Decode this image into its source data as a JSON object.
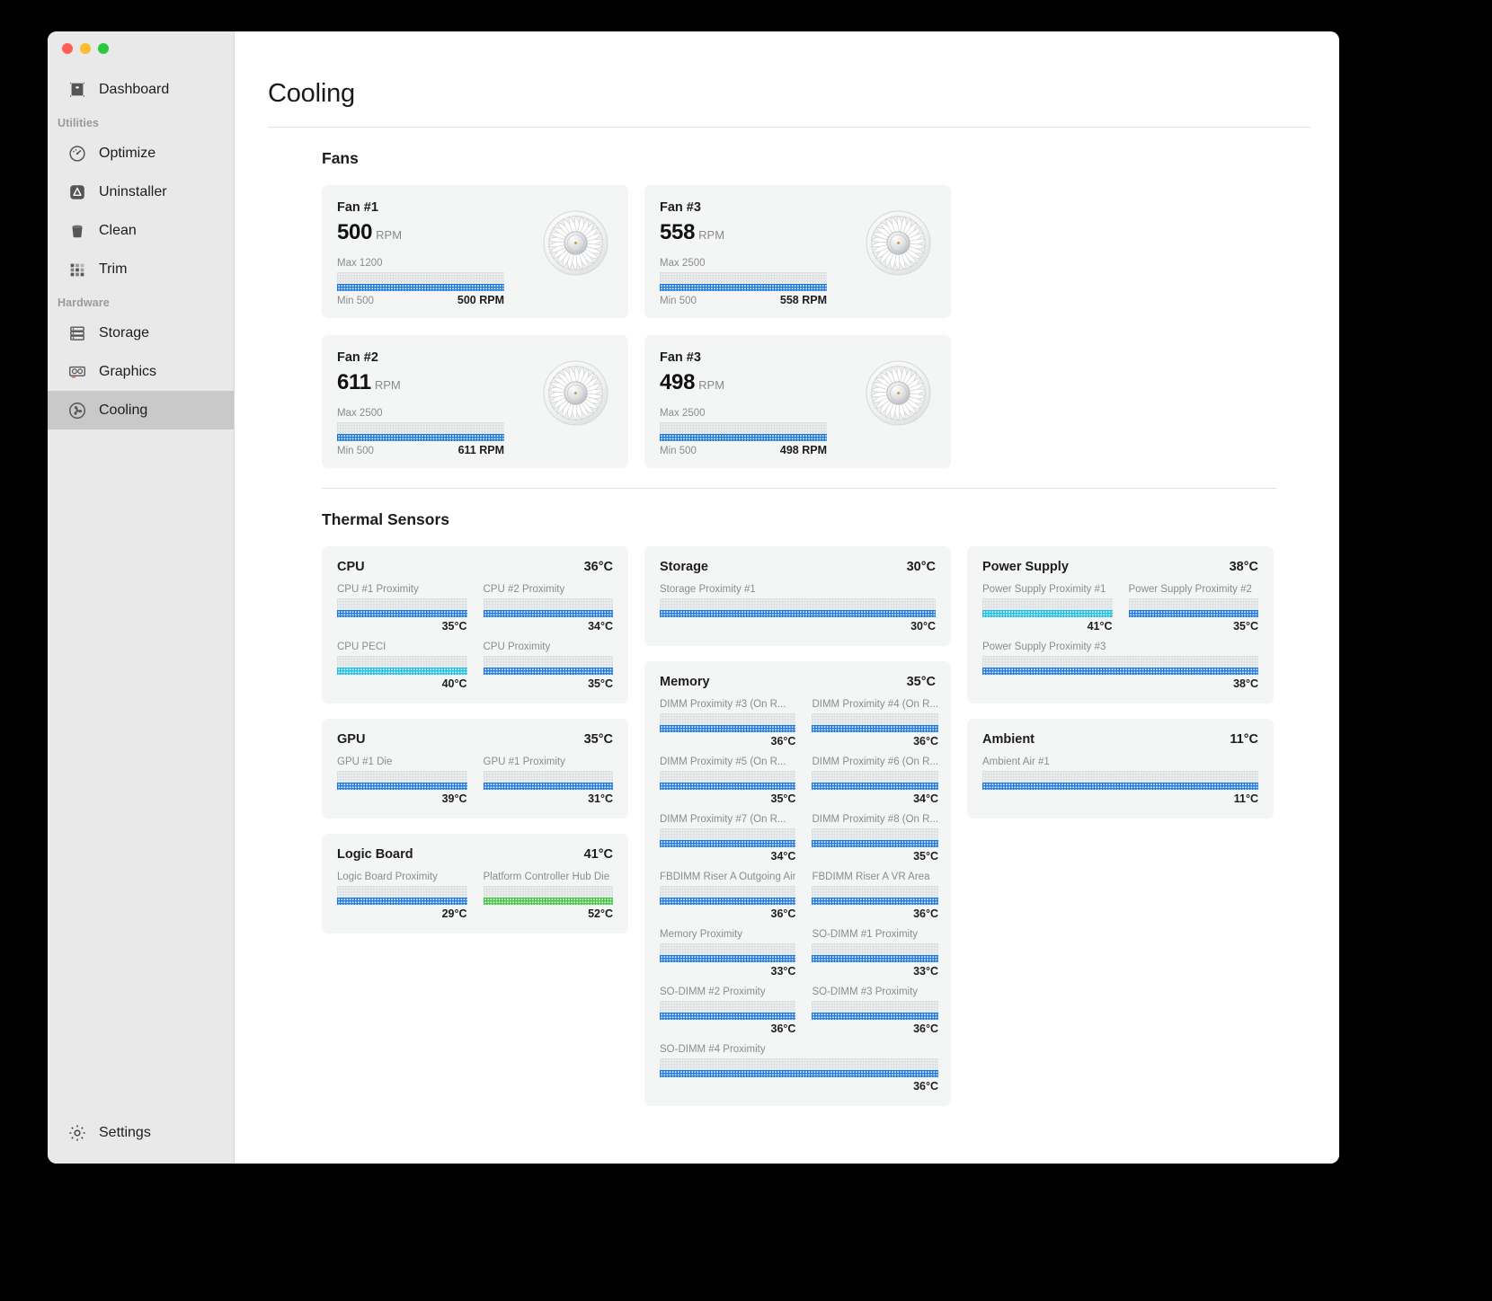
{
  "window": {
    "traffic_lights": [
      "close",
      "minimize",
      "zoom"
    ],
    "title": "Cooling"
  },
  "sidebar": {
    "items": [
      {
        "label": "Dashboard",
        "icon": "mac-pro-icon",
        "active": false
      },
      {
        "label": "Optimize",
        "icon": "gauge-icon",
        "active": false
      },
      {
        "label": "Uninstaller",
        "icon": "app-store-icon",
        "active": false
      },
      {
        "label": "Clean",
        "icon": "trash-icon",
        "active": false
      },
      {
        "label": "Trim",
        "icon": "grid-dots-icon",
        "active": false
      },
      {
        "label": "Storage",
        "icon": "drive-stack-icon",
        "active": false
      },
      {
        "label": "Graphics",
        "icon": "gpu-card-icon",
        "active": false
      },
      {
        "label": "Cooling",
        "icon": "fan-icon",
        "active": true
      }
    ],
    "groups": {
      "utilities": "Utilities",
      "hardware": "Hardware"
    },
    "settings": {
      "label": "Settings",
      "icon": "gear-icon"
    }
  },
  "main": {
    "page_title": "Cooling",
    "fans_section_title": "Fans",
    "thermal_section_title": "Thermal Sensors"
  },
  "colors": {
    "blue": "#1878e0",
    "cyan": "#18c0e8",
    "green": "#3cc73c",
    "track": "#dddfe1",
    "card_bg": "#f4f5f5",
    "sidebar_bg": "#e9e9e9",
    "sidebar_active": "#c9c9c9"
  },
  "fans": [
    {
      "name": "Fan #1",
      "value": "500",
      "unit": "RPM",
      "max_label": "Max 1200",
      "min_label": "Min 500",
      "reading": "500 RPM",
      "fill_pct": 100,
      "color": "blue"
    },
    {
      "name": "Fan #3",
      "value": "558",
      "unit": "RPM",
      "max_label": "Max 2500",
      "min_label": "Min 500",
      "reading": "558 RPM",
      "fill_pct": 100,
      "color": "blue"
    },
    {
      "name": "Fan #2",
      "value": "611",
      "unit": "RPM",
      "max_label": "Max 2500",
      "min_label": "Min 500",
      "reading": "611 RPM",
      "fill_pct": 100,
      "color": "blue"
    },
    {
      "name": "Fan #3",
      "value": "498",
      "unit": "RPM",
      "max_label": "Max 2500",
      "min_label": "Min 500",
      "reading": "498 RPM",
      "fill_pct": 100,
      "color": "blue"
    }
  ],
  "sensor_columns": [
    [
      {
        "name": "CPU",
        "temp": "36°C",
        "probes": [
          {
            "label": "CPU #1 Proximity",
            "value": "35°C",
            "color": "blue",
            "full": false
          },
          {
            "label": "CPU #2 Proximity",
            "value": "34°C",
            "color": "blue",
            "full": false
          },
          {
            "label": "CPU PECI",
            "value": "40°C",
            "color": "cyan",
            "full": false
          },
          {
            "label": "CPU Proximity",
            "value": "35°C",
            "color": "blue",
            "full": false
          }
        ]
      },
      {
        "name": "GPU",
        "temp": "35°C",
        "probes": [
          {
            "label": "GPU #1 Die",
            "value": "39°C",
            "color": "blue",
            "full": false
          },
          {
            "label": "GPU #1 Proximity",
            "value": "31°C",
            "color": "blue",
            "full": false
          }
        ]
      },
      {
        "name": "Logic Board",
        "temp": "41°C",
        "probes": [
          {
            "label": "Logic Board Proximity",
            "value": "29°C",
            "color": "blue",
            "full": false
          },
          {
            "label": "Platform Controller Hub Die",
            "value": "52°C",
            "color": "green",
            "full": false
          }
        ]
      }
    ],
    [
      {
        "name": "Storage",
        "temp": "30°C",
        "probes": [
          {
            "label": "Storage Proximity #1",
            "value": "30°C",
            "color": "blue",
            "full": true
          }
        ]
      },
      {
        "name": "Memory",
        "temp": "35°C",
        "probes": [
          {
            "label": "DIMM Proximity #3 (On R...",
            "value": "36°C",
            "color": "blue",
            "full": false
          },
          {
            "label": "DIMM Proximity #4 (On R...",
            "value": "36°C",
            "color": "blue",
            "full": false
          },
          {
            "label": "DIMM Proximity #5 (On R...",
            "value": "35°C",
            "color": "blue",
            "full": false
          },
          {
            "label": "DIMM Proximity #6 (On R...",
            "value": "34°C",
            "color": "blue",
            "full": false
          },
          {
            "label": "DIMM Proximity #7 (On R...",
            "value": "34°C",
            "color": "blue",
            "full": false
          },
          {
            "label": "DIMM Proximity #8 (On R...",
            "value": "35°C",
            "color": "blue",
            "full": false
          },
          {
            "label": "FBDIMM Riser A Outgoing Air",
            "value": "36°C",
            "color": "blue",
            "full": false
          },
          {
            "label": "FBDIMM Riser A VR Area",
            "value": "36°C",
            "color": "blue",
            "full": false
          },
          {
            "label": "Memory Proximity",
            "value": "33°C",
            "color": "blue",
            "full": false
          },
          {
            "label": "SO-DIMM #1 Proximity",
            "value": "33°C",
            "color": "blue",
            "full": false
          },
          {
            "label": "SO-DIMM #2 Proximity",
            "value": "36°C",
            "color": "blue",
            "full": false
          },
          {
            "label": "SO-DIMM #3 Proximity",
            "value": "36°C",
            "color": "blue",
            "full": false
          },
          {
            "label": "SO-DIMM #4 Proximity",
            "value": "36°C",
            "color": "blue",
            "full": true
          }
        ]
      }
    ],
    [
      {
        "name": "Power Supply",
        "temp": "38°C",
        "probes": [
          {
            "label": "Power Supply Proximity #1",
            "value": "41°C",
            "color": "cyan",
            "full": false
          },
          {
            "label": "Power Supply Proximity #2",
            "value": "35°C",
            "color": "blue",
            "full": false
          },
          {
            "label": "Power Supply Proximity #3",
            "value": "38°C",
            "color": "blue",
            "full": true
          }
        ]
      },
      {
        "name": "Ambient",
        "temp": "11°C",
        "probes": [
          {
            "label": "Ambient Air #1",
            "value": "11°C",
            "color": "blue",
            "full": true
          }
        ]
      }
    ]
  ]
}
